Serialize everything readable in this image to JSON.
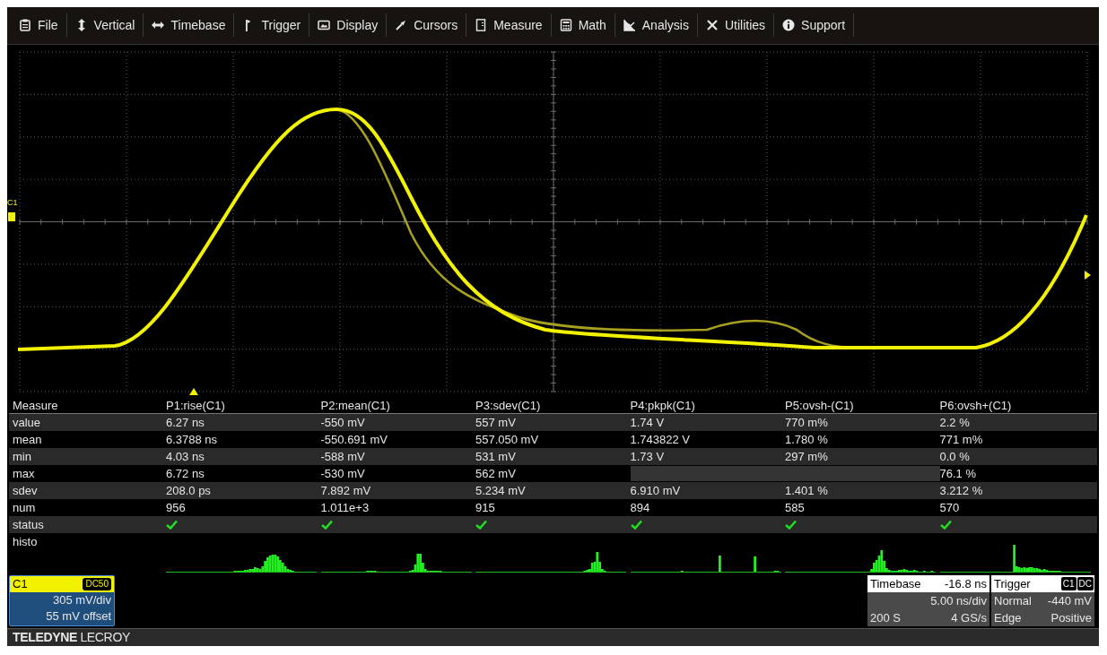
{
  "menu": [
    {
      "label": "File"
    },
    {
      "label": "Vertical"
    },
    {
      "label": "Timebase"
    },
    {
      "label": "Trigger"
    },
    {
      "label": "Display"
    },
    {
      "label": "Cursors"
    },
    {
      "label": "Measure"
    },
    {
      "label": "Math"
    },
    {
      "label": "Analysis"
    },
    {
      "label": "Utilities"
    },
    {
      "label": "Support"
    }
  ],
  "grid": {
    "channel_marker": "C1"
  },
  "measure": {
    "header": "Measure",
    "row_labels": [
      "value",
      "mean",
      "min",
      "max",
      "sdev",
      "num",
      "status",
      "histo"
    ],
    "params": [
      {
        "name": "P1:rise(C1)",
        "value": "6.27 ns",
        "mean": "6.3788 ns",
        "min": "4.03 ns",
        "max": "6.72 ns",
        "sdev": "208.0 ps",
        "num": "956",
        "status_ok": true
      },
      {
        "name": "P2:mean(C1)",
        "value": "-550 mV",
        "mean": "-550.691 mV",
        "min": "-588 mV",
        "max": "-530 mV",
        "sdev": "7.892 mV",
        "num": "1.011e+3",
        "status_ok": true
      },
      {
        "name": "P3:sdev(C1)",
        "value": "557 mV",
        "mean": "557.050 mV",
        "min": "531 mV",
        "max": "562 mV",
        "sdev": "5.234 mV",
        "num": "915",
        "status_ok": true
      },
      {
        "name": "P4:pkpk(C1)",
        "value": "1.74 V",
        "mean": "1.743822 V",
        "min": "1.73 V",
        "sdev": "6.910 mV",
        "num": "894",
        "status_ok": true
      },
      {
        "name": "P5:ovsh-(C1)",
        "value": "770 m%",
        "mean": "1.780 %",
        "min": "297 m%",
        "sdev": "1.401 %",
        "num": "585",
        "status_ok": true
      },
      {
        "name": "P6:ovsh+(C1)",
        "value": "2.2 %",
        "mean": "771 m%",
        "min": "0.0 %",
        "max": "76.1 %",
        "sdev": "3.212 %",
        "num": "570",
        "status_ok": true
      }
    ]
  },
  "channel": {
    "name": "C1",
    "coupling": "DC50",
    "scale": "305 mV/div",
    "offset": "55 mV offset"
  },
  "timebase": {
    "label": "Timebase",
    "delay": "-16.8 ns",
    "scale": "5.00 ns/div",
    "samples": "200 S",
    "rate": "4 GS/s"
  },
  "trigger": {
    "label": "Trigger",
    "source": "C1",
    "coupling": "DC",
    "mode": "Normal",
    "trigger_level": "-440 mV",
    "type": "Edge",
    "slope": "Positive"
  },
  "brand": "**TELEDYNE** LECROY"
}
